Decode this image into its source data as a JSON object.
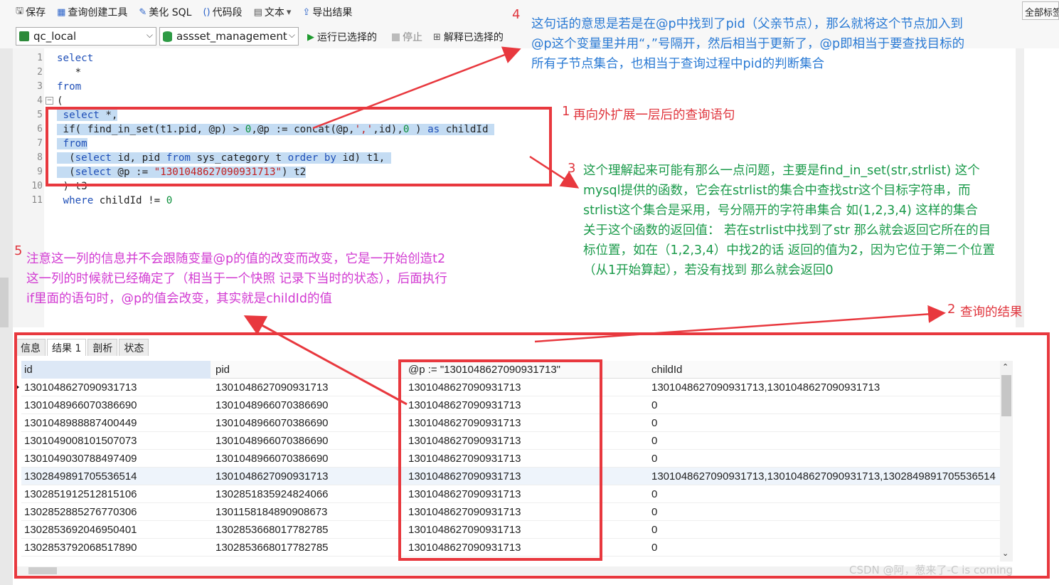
{
  "toolbar": {
    "save": "保存",
    "query_builder": "查询创建工具",
    "beautify": "美化 SQL",
    "snippet": "代码段",
    "text": "文本",
    "export": "导出结果",
    "all_tabs": "全部标签"
  },
  "connection": {
    "conn_name": "qc_local",
    "db_name": "assset_management",
    "run_selected": "运行已选择的",
    "stop": "停止",
    "explain_selected": "解释已选择的"
  },
  "editor": {
    "lines": [
      {
        "n": "1",
        "tokens": [
          {
            "t": "select",
            "c": "kw"
          }
        ]
      },
      {
        "n": "2",
        "tokens": [
          {
            "t": "   *",
            "c": ""
          }
        ]
      },
      {
        "n": "3",
        "tokens": [
          {
            "t": "from",
            "c": "kw"
          }
        ]
      },
      {
        "n": "4",
        "tokens": [
          {
            "t": "(",
            "c": ""
          }
        ]
      },
      {
        "n": "5",
        "tokens": [
          {
            "t": " ",
            "c": ""
          },
          {
            "t": "select",
            "c": "kw"
          },
          {
            "t": " *,",
            "c": ""
          }
        ]
      },
      {
        "n": "6",
        "tokens": [
          {
            "t": " if( find_in_set(t1.pid, @p) > ",
            "c": ""
          },
          {
            "t": "0",
            "c": "num"
          },
          {
            "t": ",@p := concat(@p,",
            "c": ""
          },
          {
            "t": "','",
            "c": "str"
          },
          {
            "t": ",id),",
            "c": ""
          },
          {
            "t": "0",
            "c": "num"
          },
          {
            "t": " ) ",
            "c": ""
          },
          {
            "t": "as",
            "c": "kw"
          },
          {
            "t": " childId ",
            "c": ""
          }
        ]
      },
      {
        "n": "7",
        "tokens": [
          {
            "t": " ",
            "c": ""
          },
          {
            "t": "from",
            "c": "kw"
          }
        ]
      },
      {
        "n": "8",
        "tokens": [
          {
            "t": "  (",
            "c": ""
          },
          {
            "t": "select",
            "c": "kw"
          },
          {
            "t": " id, pid ",
            "c": ""
          },
          {
            "t": "from",
            "c": "kw"
          },
          {
            "t": " sys_category t ",
            "c": ""
          },
          {
            "t": "order by",
            "c": "kw"
          },
          {
            "t": " id) t1, ",
            "c": ""
          }
        ]
      },
      {
        "n": "9",
        "tokens": [
          {
            "t": "  (",
            "c": ""
          },
          {
            "t": "select",
            "c": "kw"
          },
          {
            "t": " @p := ",
            "c": ""
          },
          {
            "t": "\"1301048627090931713\"",
            "c": "str"
          },
          {
            "t": ") t2",
            "c": ""
          }
        ]
      },
      {
        "n": "10",
        "tokens": [
          {
            "t": " ) t3",
            "c": ""
          }
        ]
      },
      {
        "n": "11",
        "tokens": [
          {
            "t": " ",
            "c": ""
          },
          {
            "t": "where",
            "c": "kw"
          },
          {
            "t": " childId != ",
            "c": ""
          },
          {
            "t": "0",
            "c": "num"
          }
        ]
      }
    ]
  },
  "results": {
    "tabs": [
      "信息",
      "结果 1",
      "剖析",
      "状态"
    ],
    "columns": [
      "id",
      "pid",
      "@p := \"1301048627090931713\"",
      "childId"
    ],
    "rows": [
      [
        "1301048627090931713",
        "1301048627090931713",
        "1301048627090931713",
        "1301048627090931713,1301048627090931713"
      ],
      [
        "1301048966070386690",
        "1301048966070386690",
        "1301048627090931713",
        "0"
      ],
      [
        "1301048988887400449",
        "1301048966070386690",
        "1301048627090931713",
        "0"
      ],
      [
        "1301049008101507073",
        "1301048966070386690",
        "1301048627090931713",
        "0"
      ],
      [
        "1301049030788497409",
        "1301048966070386690",
        "1301048627090931713",
        "0"
      ],
      [
        "1302849891705536514",
        "1301048627090931713",
        "1301048627090931713",
        "1301048627090931713,1301048627090931713,1302849891705536514"
      ],
      [
        "1302851912512815106",
        "1302851835924824066",
        "1301048627090931713",
        "0"
      ],
      [
        "1302852885276770306",
        "1301158184890908673",
        "1301048627090931713",
        "0"
      ],
      [
        "1302853692046950401",
        "1302853668017782785",
        "1301048627090931713",
        "0"
      ],
      [
        "1302853792068517890",
        "1302853668017782785",
        "1301048627090931713",
        "0"
      ]
    ]
  },
  "annotations": {
    "a1_num": "1",
    "a1_text": "再向外扩展一层后的查询语句",
    "a2_num": "2",
    "a2_text": "查询的结果",
    "a3_num": "3",
    "a3_lines": [
      "这个理解起来可能有那么一点问题，主要是find_in_set(str,strlist) 这个",
      "mysql提供的函数，它会在strlist的集合中查找str这个目标字符串，而",
      "strlist这个集合是采用，号分隔开的字符串集合 如(1,2,3,4) 这样的集合",
      "关于这个函数的返回值： 若在strlist中找到了str 那么就会返回它所在的目",
      "标位置，如在（1,2,3,4）中找2的话 返回的值为2，因为它位于第二个位置",
      "（从1开始算起），若没有找到  那么就会返回0"
    ],
    "a4_num": "4",
    "a4_lines": [
      "这句话的意思是若是在@p中找到了pid（父亲节点），那么就将这个节点加入到",
      "@p这个变量里并用“，”号隔开，然后相当于更新了，@p即相当于要查找目标的",
      "所有子节点集合，也相当于查询过程中pid的判断集合"
    ],
    "a5_num": "5",
    "a5_lines": [
      "注意这一列的信息并不会跟随变量@p的值的改变而改变，它是一开始创造t2",
      "这一列的时候就已经确定了（相当于一个快照 记录下当时的状态），后面执行",
      "if里面的语句时，@p的值会改变，其实就是childId的值"
    ]
  },
  "watermark": "CSDN @阿，葱来了-C is coming",
  "colors": {
    "annotation_red": "#e8383e",
    "annotation_blue": "#2a7ad4",
    "annotation_green": "#1a9a4a",
    "annotation_magenta": "#d23bd2",
    "selection": "#c4dcf3"
  }
}
